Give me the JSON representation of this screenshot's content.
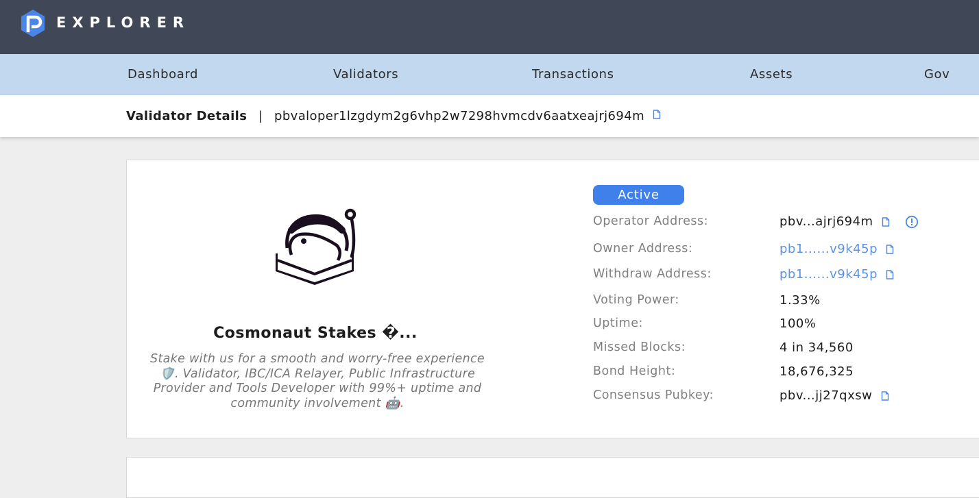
{
  "header": {
    "app_name": "EXPLORER",
    "logo_icon": "p-logo-icon"
  },
  "nav": {
    "items": [
      {
        "label": "Dashboard"
      },
      {
        "label": "Validators"
      },
      {
        "label": "Transactions"
      },
      {
        "label": "Assets"
      },
      {
        "label": "Gov"
      }
    ]
  },
  "breadcrumb": {
    "title": "Validator Details",
    "separator": "|",
    "address": "pbvaloper1lzgdym2g6vhp2w7298hvmcdv6aatxeajrj694m"
  },
  "validator": {
    "status": "Active",
    "name": "Cosmonaut Stakes �...",
    "description": "Stake with us for a smooth and worry-free experience 🛡️. Validator, IBC/ICA Relayer, Public Infrastructure Provider and Tools Developer with 99%+ uptime and community involvement 🤖.",
    "details": {
      "operator_label": "Operator Address:",
      "operator_value": "pbv...ajrj694m",
      "owner_label": "Owner Address:",
      "owner_value": "pb1......v9k45p",
      "withdraw_label": "Withdraw Address:",
      "withdraw_value": "pb1......v9k45p",
      "voting_power_label": "Voting Power:",
      "voting_power_value": "1.33%",
      "uptime_label": "Uptime:",
      "uptime_value": "100%",
      "missed_blocks_label": "Missed Blocks:",
      "missed_blocks_value": "4 in 34,560",
      "bond_height_label": "Bond Height:",
      "bond_height_value": "18,676,325",
      "consensus_label": "Consensus Pubkey:",
      "consensus_value": "pbv...jj27qxsw"
    }
  },
  "colors": {
    "topbar": "#404756",
    "navbar": "#c1d8ee",
    "accent": "#3f80ea",
    "link": "#5a92e6"
  }
}
